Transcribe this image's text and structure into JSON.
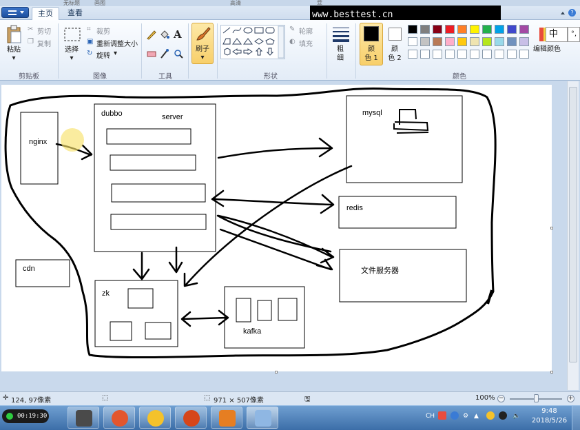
{
  "window": {
    "title_fragment_left": "无标题",
    "title_fragment_right": "画图",
    "overlay_left": "高清",
    "overlay_right": "登陆"
  },
  "watermark": "www.besttest.cn",
  "tabs": [
    {
      "label": "主页",
      "active": true
    },
    {
      "label": "查看",
      "active": false
    }
  ],
  "ribbon": {
    "clipboard": {
      "paste": "粘贴",
      "cut": "剪切",
      "copy": "复制",
      "group": "剪贴板"
    },
    "image": {
      "select": "选择",
      "crop": "裁剪",
      "resize": "重新调整大小",
      "rotate": "旋转",
      "group": "图像"
    },
    "tools": {
      "group": "工具",
      "text_glyph": "A"
    },
    "brushes": {
      "label": "刷子"
    },
    "shapes": {
      "outline": "轮廓",
      "fill": "填充",
      "group": "形状"
    },
    "size": {
      "label_1": "粗",
      "label_2": "细"
    },
    "colors": {
      "color1_line1": "颜",
      "color1_line2": "色 1",
      "color2_line1": "颜",
      "color2_line2": "色 2",
      "edit": "编辑颜色",
      "group": "颜色",
      "color1": "#000000",
      "color2": "#ffffff",
      "palette_row1": [
        "#000000",
        "#7f7f7f",
        "#880015",
        "#ed1c24",
        "#ff7f27",
        "#fff200",
        "#22b14c",
        "#00a2e8",
        "#3f48cc",
        "#a349a4"
      ],
      "palette_row2": [
        "#ffffff",
        "#c3c3c3",
        "#b97a57",
        "#ffaec9",
        "#ffc90e",
        "#efe4b0",
        "#b5e61d",
        "#99d9ea",
        "#7092be",
        "#c8bfe7"
      ],
      "palette_row3": [
        "#ffffff",
        "#ffffff",
        "#ffffff",
        "#ffffff",
        "#ffffff",
        "#ffffff",
        "#ffffff",
        "#ffffff",
        "#ffffff",
        "#ffffff"
      ]
    },
    "ime": {
      "label": "中",
      "extra": "°,"
    }
  },
  "canvas": {
    "labels": {
      "nginx": "nginx",
      "dubbo": "dubbo",
      "server": "server",
      "mysql": "mysql",
      "redis": "redis",
      "file_server": "文件服务器",
      "cdn": "cdn",
      "zk": "zk",
      "kafka": "kafka"
    }
  },
  "statusbar": {
    "cursor": "124, 97像素",
    "image_size": "971 × 507像素",
    "zoom": "100%",
    "zoom_level": 1.0
  },
  "taskbar": {
    "recorder_time": "00:19:30",
    "ime": "CH",
    "time": "9:48",
    "date": "2018/5/26"
  }
}
